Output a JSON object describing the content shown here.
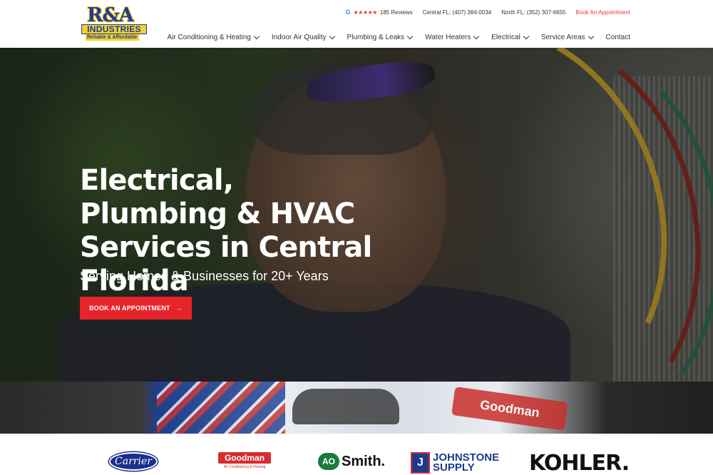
{
  "logo": {
    "mark": "R&A",
    "line2": "INDUSTRIES",
    "tagline": "Reliable & Affordable"
  },
  "topbar": {
    "google_icon": "G",
    "stars": "★★★★★",
    "reviews": "185 Reviews",
    "central_phone": "Central FL: (407) 384-0034",
    "north_phone": "North FL: (352) 307-6655",
    "book_link": "Book An Appointment"
  },
  "nav": {
    "items": [
      {
        "label": "Air Conditioning & Heating",
        "dropdown": true
      },
      {
        "label": "Indoor Air Quality",
        "dropdown": true
      },
      {
        "label": "Plumbing & Leaks",
        "dropdown": true
      },
      {
        "label": "Water Heaters",
        "dropdown": true
      },
      {
        "label": "Electrical",
        "dropdown": true
      },
      {
        "label": "Service Areas",
        "dropdown": true
      },
      {
        "label": "Contact",
        "dropdown": false
      }
    ]
  },
  "hero": {
    "title": "Electrical, Plumbing & HVAC Services in Central Florida",
    "subtitle": "Serving Homes & Businesses for 20+ Years",
    "cta_label": "BOOK AN APPOINTMENT",
    "cta_arrow": "→"
  },
  "van": {
    "sticker": "Goodman"
  },
  "brands": {
    "carrier": "Carrier",
    "goodman": "Goodman",
    "goodman_sub": "Air Conditioning & Heating",
    "aosmith_mark": "AO",
    "aosmith_text": "Smith.",
    "johnstone_mark": "J",
    "johnstone_line1": "JOHNSTONE",
    "johnstone_line2": "SUPPLY",
    "kohler": "KOHLER."
  },
  "colors": {
    "accent_red": "#e8242b",
    "brand_blue": "#1e3a9c",
    "brand_yellow": "#f2d22b"
  }
}
